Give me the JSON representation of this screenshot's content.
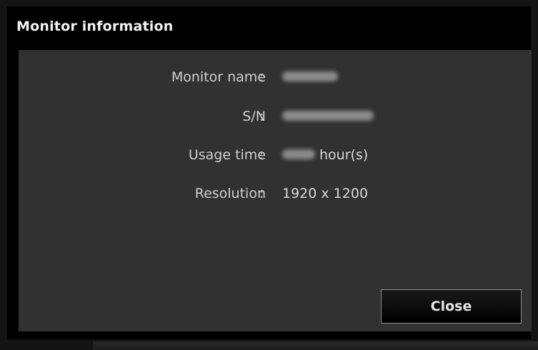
{
  "dialog": {
    "title": "Monitor information",
    "close_label": "Close"
  },
  "fields": [
    {
      "label": "Monitor name",
      "separator": ":",
      "value": ""
    },
    {
      "label": "S/N",
      "separator": ":",
      "value": ""
    },
    {
      "label": "Usage time",
      "separator": ":",
      "value": "",
      "unit": "hour(s)"
    },
    {
      "label": "Resolution",
      "separator": ":",
      "value": "1920 x 1200"
    }
  ]
}
